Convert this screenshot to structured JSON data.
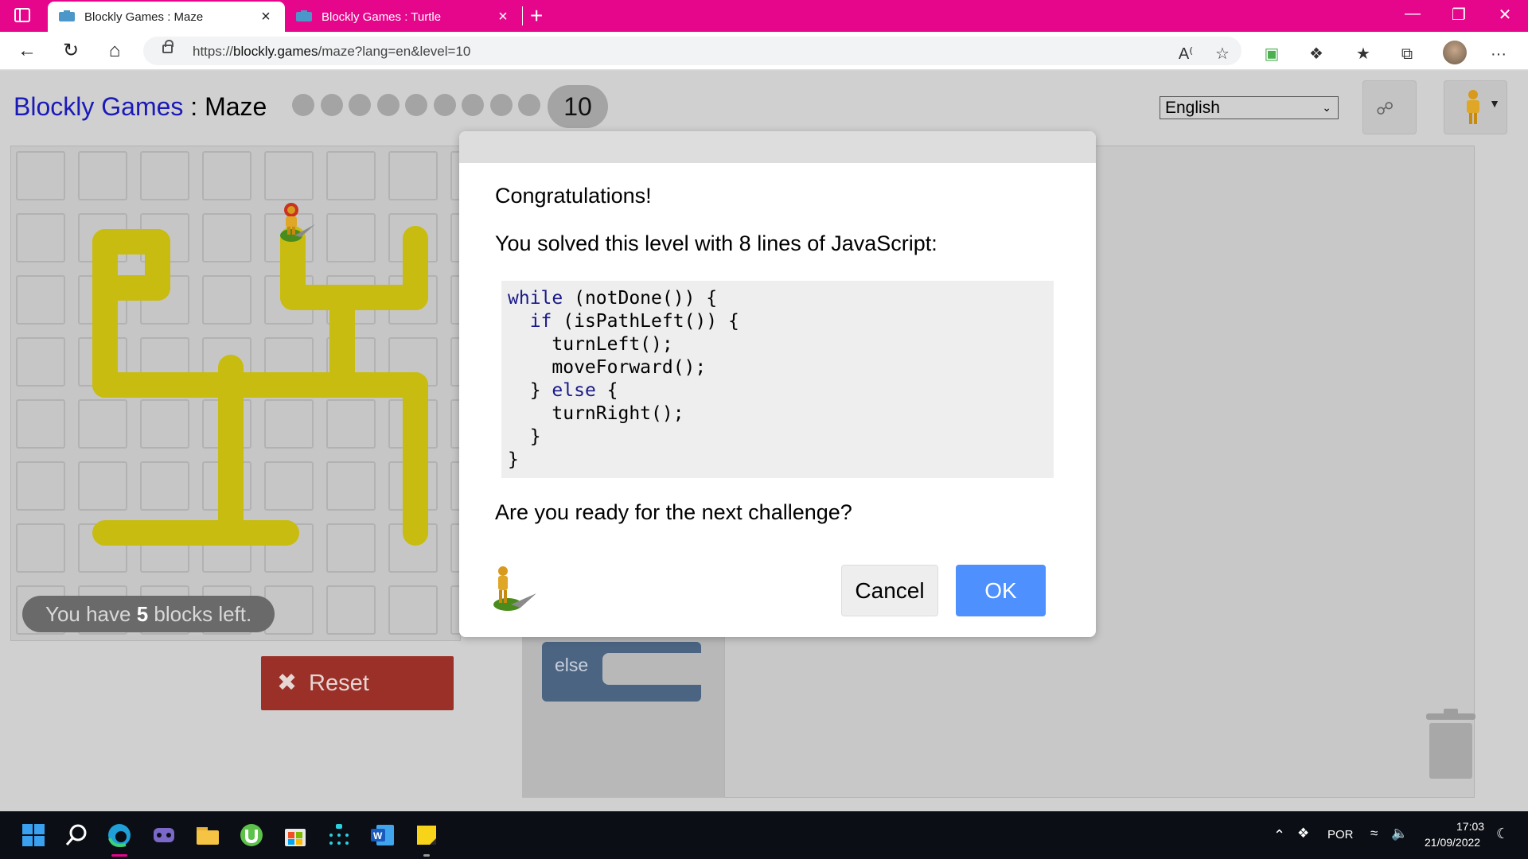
{
  "browser": {
    "tabs": [
      {
        "title": "Blockly Games : Maze",
        "active": true
      },
      {
        "title": "Blockly Games : Turtle",
        "active": false
      }
    ],
    "url_prefix": "https://",
    "url_domain": "blockly.games",
    "url_path": "/maze?lang=en&level=10",
    "tab_close_glyph": "×",
    "new_tab_glyph": "+",
    "more_glyph": "···"
  },
  "page": {
    "title_link": "Blockly Games",
    "title_sep": " : ",
    "title_game": "Maze",
    "current_level": "10",
    "completed_levels": 9,
    "language": "English",
    "blocks_left_prefix": "You have ",
    "blocks_left_count": "5",
    "blocks_left_suffix": " blocks left.",
    "reset_label": "Reset",
    "else_label": "else"
  },
  "dialog": {
    "congrats": "Congratulations!",
    "solved": "You solved this level with 8 lines of JavaScript:",
    "code": [
      {
        "indent": "",
        "kw": "while",
        "rest": " (notDone()) {"
      },
      {
        "indent": "  ",
        "kw": "if",
        "rest": " (isPathLeft()) {"
      },
      {
        "indent": "    ",
        "kw": "",
        "rest": "turnLeft();"
      },
      {
        "indent": "    ",
        "kw": "",
        "rest": "moveForward();"
      },
      {
        "indent": "  ",
        "kw": "",
        "rest": "} else {"
      },
      {
        "indent": "    ",
        "kw": "",
        "rest": "turnRight();"
      },
      {
        "indent": "  ",
        "kw": "",
        "rest": "}"
      },
      {
        "indent": "",
        "kw": "",
        "rest": "}"
      }
    ],
    "ready": "Are you ready for the next challenge?",
    "cancel_label": "Cancel",
    "ok_label": "OK"
  },
  "taskbar": {
    "language": "POR",
    "time": "17:03",
    "date": "21/09/2022"
  },
  "colors": {
    "tab_bar": "#e6068c",
    "road": "#c8bc10",
    "ok_button": "#4d90fe",
    "reset_button": "#9a3028",
    "level_link": "#1a1ab8"
  }
}
